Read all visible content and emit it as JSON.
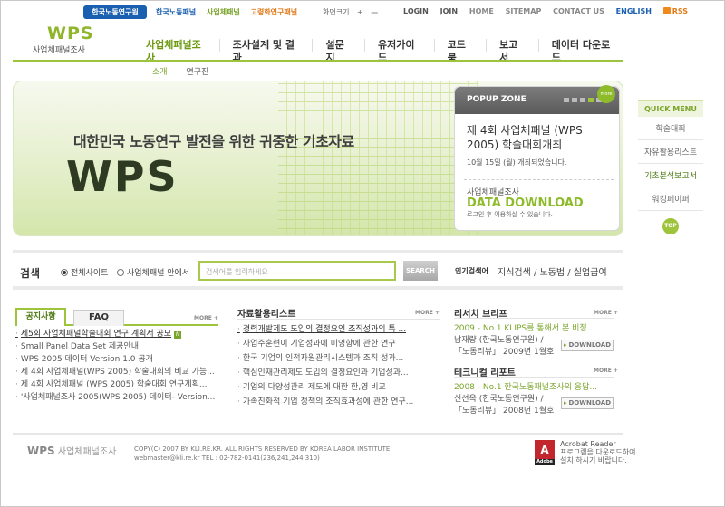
{
  "top": {
    "pill": "한국노동연구원",
    "sites": [
      "한국노동패널",
      "사업체패널",
      "고령화연구패널"
    ],
    "fontsize_label": "화면크기",
    "fontsize_plus": "+",
    "fontsize_minus": "—",
    "util": [
      "LOGIN",
      "JOIN",
      "HOME",
      "SITEMAP",
      "CONTACT US"
    ],
    "english": "ENGLISH",
    "rss": "RSS"
  },
  "logo": {
    "main": "WPS",
    "sub": "사업체패널조사"
  },
  "gnb": [
    "사업체패널조사",
    "조사설계 및 결과",
    "설문지",
    "유저가이드",
    "코드북",
    "보고서",
    "데이터 다운로드"
  ],
  "subnav": [
    "소개",
    "연구진"
  ],
  "banner": {
    "slogan": "대한민국 노동연구 발전을 위한 귀중한 기초자료",
    "big": "WPS",
    "popup": {
      "head": "POPUP ZONE",
      "badge": "more",
      "title": "제 4회 사업체패널 (WPS 2005) 학술대회개최",
      "date": "10월 15일 (월) 개최되었습니다.",
      "dl_small": "사업체패널조사",
      "dl_big": "DATA DOWNLOAD",
      "dl_note": "로그인 후 이용하실 수 있습니다."
    }
  },
  "quick": {
    "title": "QUICK MENU",
    "items": [
      "학술대회",
      "자유활용리스트",
      "기초분석보고서",
      "워킹페이퍼"
    ],
    "top": "TOP"
  },
  "search": {
    "label": "검색",
    "opt1": "전체사이트",
    "opt2": "사업체패널 안에서",
    "placeholder": "검색어를 입력하세요",
    "button": "SEARCH",
    "pop_label": "인기검색어",
    "pop_words": "지식검색 / 노동법 / 실업급여"
  },
  "notice": {
    "tab1": "공지사항",
    "tab2": "FAQ",
    "more": "MORE +",
    "items": [
      "제5회 사업체패널학술대회 연구 계획서 공모",
      "Small Panel Data Set 제공안내",
      "WPS 2005 데이터 Version 1.0 공개",
      "제 4회 사업체패널(WPS 2005) 학술대회의 비교 가능...",
      "제 4회 사업체패널 (WPS 2005) 학술대회 연구계획...",
      "'사업체패널조사 2005(WPS 2005) 데이터- Version..."
    ]
  },
  "library": {
    "title": "자료활용리스트",
    "more": "MORE +",
    "items": [
      "경력개발제도 도입의 결정요인 조직성과의 특 ...",
      "사업주훈련이 기업성과에 미영향에 관한 연구",
      "한국 기업의 인적자원관리시스템과 조직 성과...",
      "핵심인재관리제도 도입의 결정요인과 기업성과...",
      "기업의 다양성관리 제도에 대한 한,영 비교",
      "가족친화적 기업 정책의 조직효과성에 관한 연구..."
    ]
  },
  "research": {
    "title": "리서치 브리프",
    "more": "MORE +",
    "headline": "2009 - No.1 KLIPS를 통해서 본 비정...",
    "author": "남재량 (한국노동연구원) /",
    "source": "「노동리뷰」 2009년 1월호",
    "download": "DOWNLOAD"
  },
  "tech": {
    "title": "테크니컬 리포트",
    "more": "MORE +",
    "headline": "2008 - No.1 한국노동패널조사의 응답...",
    "author": "신선옥 (한국노동연구원) /",
    "source": "「노동리뷰」 2008년 1월호",
    "download": "DOWNLOAD"
  },
  "footer": {
    "logo": "WPS",
    "logo_sub": "사업체패널조사",
    "copy1": "COPY(C) 2007 BY KLI.RE.KR. ALL RIGHTS RESERVED BY KOREA LABOR INSTITUTE",
    "copy2": "webmaster@kli.re.kr  TEL : 02-782-0141(236,241,244,310)",
    "acrobat_title": "Acrobat Reader",
    "acrobat_desc": "프로그램을 다운로드하여 설치 하시기 바랍니다.",
    "acrobat_icon": "Adobe"
  }
}
